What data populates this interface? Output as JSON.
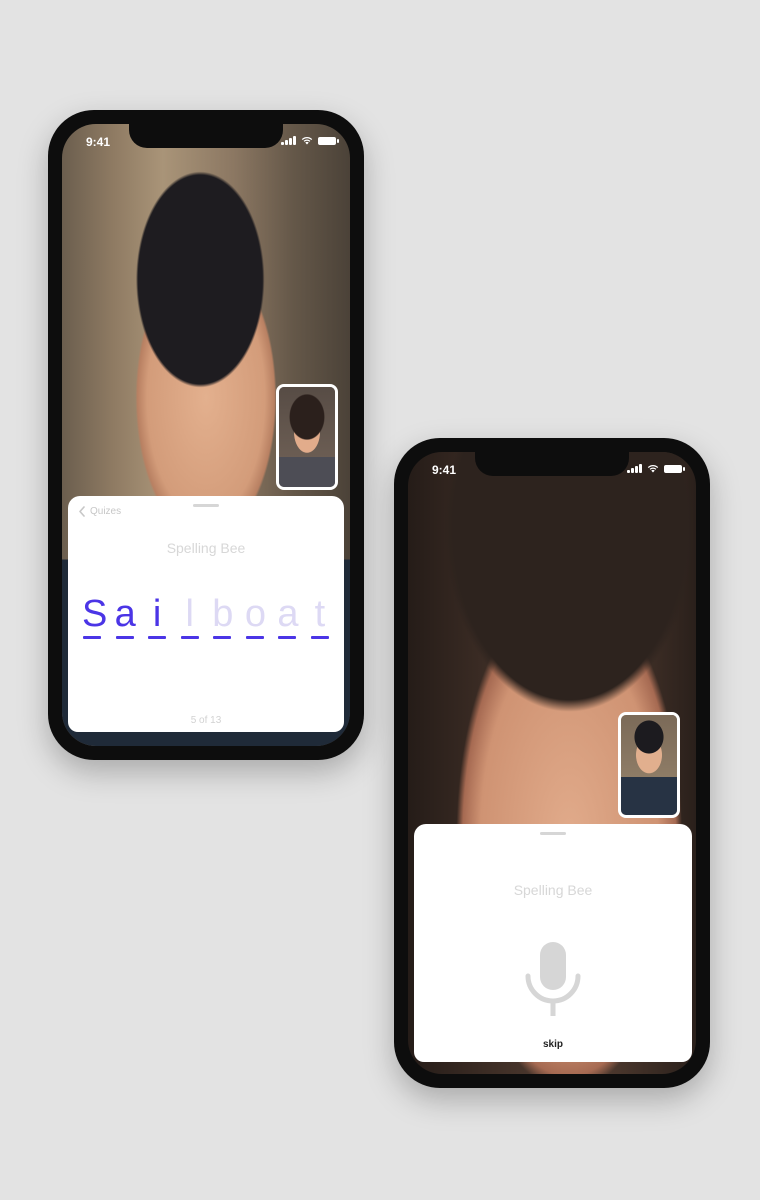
{
  "phone1": {
    "status": {
      "time": "9:41"
    },
    "sheet": {
      "back_label": "Quizes",
      "title": "Spelling Bee",
      "word": [
        "S",
        "a",
        "i",
        "l",
        "b",
        "o",
        "a",
        "t"
      ],
      "letters_filled": 3,
      "progress": "5 of 13"
    }
  },
  "phone2": {
    "status": {
      "time": "9:41"
    },
    "sheet": {
      "title": "Spelling Bee",
      "skip_label": "skip"
    }
  },
  "colors": {
    "accent": "#4b35e6",
    "accent_faded": "#ddd9f4"
  },
  "icons": [
    "back-chevron-icon",
    "signal-icon",
    "wifi-icon",
    "battery-icon",
    "microphone-icon"
  ]
}
